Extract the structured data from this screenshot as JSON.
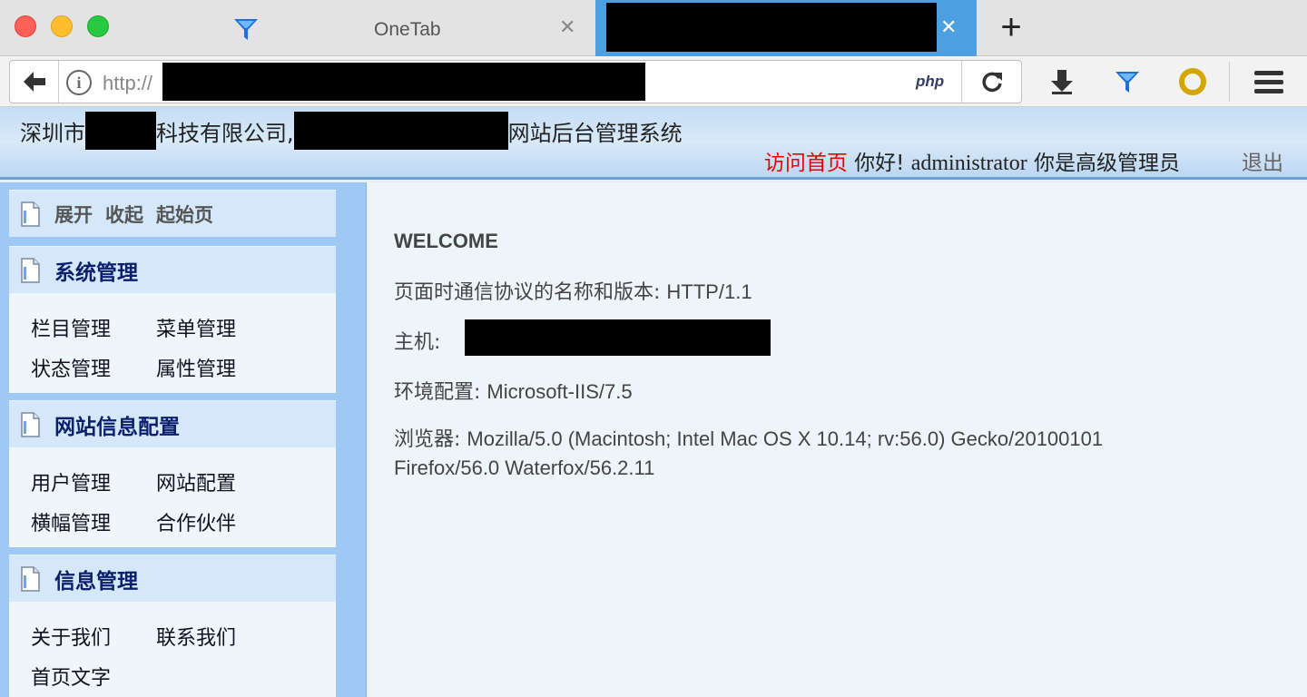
{
  "browser": {
    "tabs": [
      {
        "title": "OneTab",
        "active": false
      },
      {
        "title": "",
        "active": true
      }
    ],
    "url_prefix": "http://",
    "url_badge": "php",
    "icons": [
      "back-arrow-icon",
      "info-icon",
      "reload-icon",
      "download-icon",
      "onetab-funnel-icon",
      "ring-addon-icon",
      "hamburger-menu-icon"
    ],
    "accent_color": "#4c9fe0"
  },
  "header": {
    "title_part1": "深圳市",
    "title_part2": "科技有限公司,",
    "title_part3": "网站后台管理系统",
    "visit_home": "访问首页",
    "greeting": "你好!",
    "username": "administrator",
    "role_text": "你是高级管理员",
    "logout": "退出",
    "visit_color": "#ee0000"
  },
  "sidebar": {
    "controls": [
      "展开",
      "收起",
      "起始页"
    ],
    "sections": [
      {
        "title": "系统管理",
        "links": [
          "栏目管理",
          "菜单管理",
          "状态管理",
          "属性管理"
        ]
      },
      {
        "title": "网站信息配置",
        "links": [
          "用户管理",
          "网站配置",
          "横幅管理",
          "合作伙伴"
        ]
      },
      {
        "title": "信息管理",
        "links": [
          "关于我们",
          "联系我们",
          "首页文字"
        ]
      }
    ]
  },
  "main": {
    "welcome": "WELCOME",
    "protocol_label": "页面时通信协议的名称和版本:",
    "protocol_value": "HTTP/1.1",
    "host_label": "主机:",
    "env_label": "环境配置:",
    "env_value": "Microsoft-IIS/7.5",
    "browser_label": "浏览器:",
    "browser_value": "Mozilla/5.0 (Macintosh; Intel Mac OS X 10.14; rv:56.0) Gecko/20100101 Firefox/56.0 Waterfox/56.2.11"
  }
}
